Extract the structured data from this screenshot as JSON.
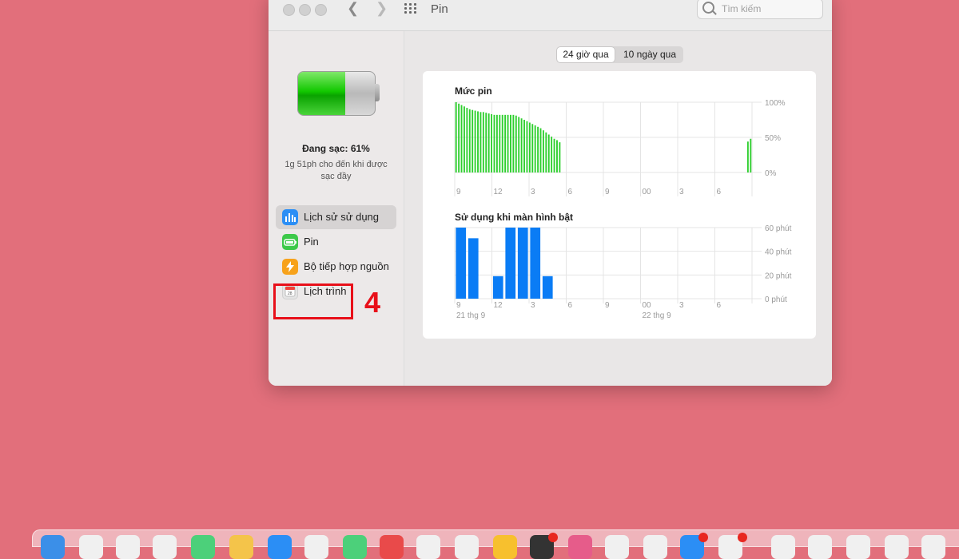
{
  "window": {
    "title": "Pin",
    "search_placeholder": "Tìm kiếm"
  },
  "sidebar": {
    "battery_percent": 61,
    "charge_status": "Đang sạc: 61%",
    "charge_detail": "1g 51ph cho đến khi được sạc đầy",
    "items": [
      {
        "label": "Lịch sử sử dụng",
        "icon": "bar-chart-icon",
        "selected": true
      },
      {
        "label": "Pin",
        "icon": "battery-icon",
        "selected": false
      },
      {
        "label": "Bộ tiếp hợp nguồn",
        "icon": "lightning-icon",
        "selected": false
      },
      {
        "label": "Lịch trình",
        "icon": "calendar-icon",
        "selected": false
      }
    ]
  },
  "annotation": {
    "step_number": "4",
    "color": "#e8101a"
  },
  "tabs": [
    {
      "label": "24 giờ qua",
      "active": true
    },
    {
      "label": "10 ngày qua",
      "active": false
    }
  ],
  "colors": {
    "battery_green": "#2ecf2e",
    "usage_blue": "#0a7cf5",
    "background": "#e26f7b"
  },
  "chart_data": [
    {
      "type": "bar",
      "title": "Mức pin",
      "yticks": [
        "100%",
        "50%",
        "0%"
      ],
      "ylim": [
        0,
        100
      ],
      "xticks": [
        "9",
        "12",
        "3",
        "6",
        "9",
        "00",
        "3",
        "6"
      ],
      "values": [
        100,
        98,
        96,
        94,
        92,
        90,
        89,
        88,
        87,
        86,
        86,
        85,
        84,
        83,
        82,
        82,
        82,
        82,
        82,
        82,
        82,
        82,
        81,
        79,
        77,
        75,
        73,
        71,
        69,
        67,
        65,
        63,
        60,
        57,
        54,
        51,
        48,
        46,
        43,
        0,
        0,
        0,
        0,
        0,
        0,
        0,
        0,
        0,
        0,
        0,
        0,
        0,
        0,
        0,
        0,
        0,
        0,
        0,
        0,
        0,
        0,
        0,
        0,
        0,
        0,
        0,
        0,
        0,
        0,
        0,
        0,
        0,
        0,
        0,
        0,
        0,
        0,
        0,
        0,
        0,
        0,
        0,
        0,
        0,
        0,
        0,
        0,
        0,
        0,
        0,
        0,
        0,
        0,
        0,
        0,
        0,
        0,
        0,
        0,
        0,
        0,
        0,
        0,
        0,
        0,
        0,
        0,
        44,
        48
      ],
      "grid": true
    },
    {
      "type": "bar",
      "title": "Sử dụng khi màn hình bật",
      "yticks": [
        "60 phút",
        "40 phút",
        "20 phút",
        "0 phút"
      ],
      "ylim": [
        0,
        60
      ],
      "xticks": [
        "9",
        "12",
        "3",
        "6",
        "9",
        "00",
        "3",
        "6"
      ],
      "date_labels": [
        "21 thg 9",
        "22 thg 9"
      ],
      "values": [
        60,
        51,
        0,
        19,
        60,
        60,
        60,
        19,
        0,
        0,
        0,
        0,
        0,
        0,
        0,
        0,
        0,
        0,
        0,
        0,
        0,
        0,
        0,
        0
      ],
      "grid": true
    }
  ]
}
